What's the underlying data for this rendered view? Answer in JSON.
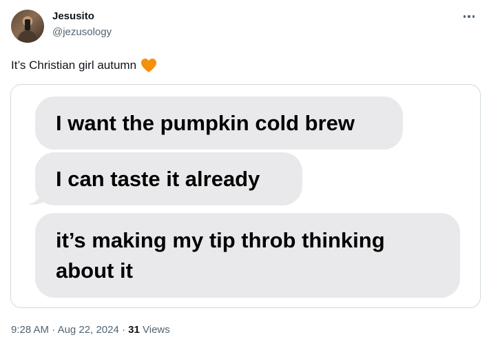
{
  "author": {
    "display_name": "Jesusito",
    "handle": "@jezusology",
    "avatar_icon": "profile-photo"
  },
  "tweet": {
    "text": "It’s Christian girl autumn",
    "emoji": "orange-heart",
    "emoji_color": "#f4900c"
  },
  "media": {
    "messages": [
      "I want the pumpkin cold brew",
      "I can taste it already",
      "it’s making my tip throb thinking about it"
    ],
    "bubble_color": "#e9e9eb"
  },
  "meta": {
    "time": "9:28 AM",
    "separator": "·",
    "date": "Aug 22, 2024",
    "views_count": "31",
    "views_label": "Views"
  },
  "icons": {
    "more": "more-icon"
  }
}
